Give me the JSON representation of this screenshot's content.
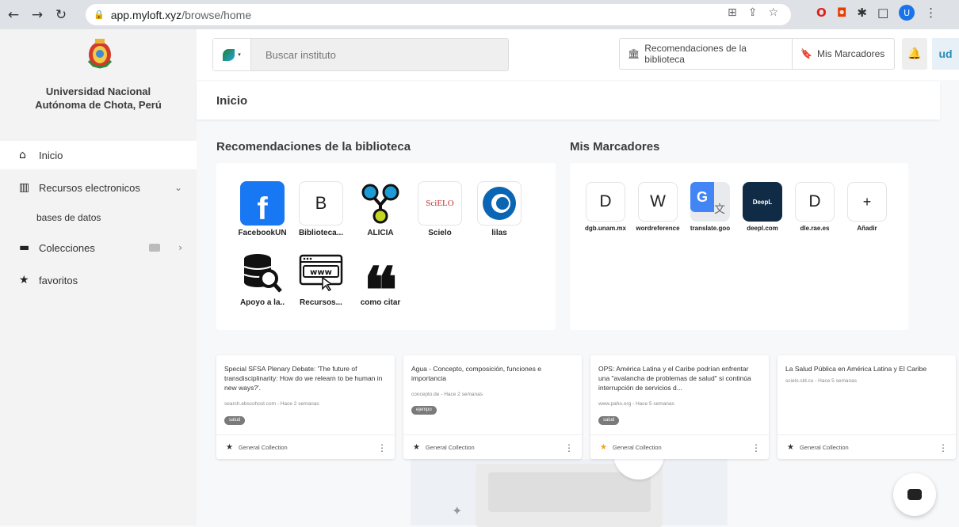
{
  "browser": {
    "url_domain": "app.myloft.xyz",
    "url_path": "/browse/home",
    "profile_initial": "U"
  },
  "sidebar": {
    "university_name": "Universidad Nacional Autónoma de Chota, Perú",
    "items": [
      {
        "label": "Inicio",
        "icon": "home-icon"
      },
      {
        "label": "Recursos electronicos",
        "icon": "book-icon"
      },
      {
        "label": "bases de datos"
      },
      {
        "label": "Colecciones",
        "icon": "archive-icon"
      },
      {
        "label": "favoritos",
        "icon": "star-icon"
      }
    ]
  },
  "topbar": {
    "search_placeholder": "Buscar instituto",
    "recommendations_label": "Recomendaciones de la biblioteca",
    "bookmarks_label": "Mis Marcadores",
    "user_initials": "ud"
  },
  "breadcrumb": {
    "title": "Inicio"
  },
  "recommendations": {
    "title": "Recomendaciones de la biblioteca",
    "items": [
      {
        "label": "FacebookUN",
        "glyph": "f"
      },
      {
        "label": "Biblioteca...",
        "glyph": "B"
      },
      {
        "label": "ALICIA",
        "glyph": ""
      },
      {
        "label": "Scielo",
        "glyph": "SciELO"
      },
      {
        "label": "lilas",
        "glyph": ""
      },
      {
        "label": "Apoyo a la..",
        "glyph": ""
      },
      {
        "label": "Recursos...",
        "glyph": "www"
      },
      {
        "label": "como citar",
        "glyph": "❝"
      }
    ]
  },
  "bookmarks": {
    "title": "Mis Marcadores",
    "items": [
      {
        "label": "dgb.unam.mx",
        "glyph": "D"
      },
      {
        "label": "wordreference",
        "glyph": "W"
      },
      {
        "label": "translate.goo",
        "glyph": "G"
      },
      {
        "label": "deepl.com",
        "glyph": "DeepL"
      },
      {
        "label": "dle.rae.es",
        "glyph": "D"
      },
      {
        "label": "Añadir",
        "glyph": "+"
      }
    ]
  },
  "cards": [
    {
      "title": "Special SFSA Plenary Debate: 'The future of transdisciplinarity: How do we relearn to be human in new ways?'.",
      "source": "search.ebscohost.com - Hace 2 semanas",
      "tag": "salud",
      "collection": "General Collection",
      "starred": false
    },
    {
      "title": "Agua - Concepto, composición, funciones e importancia",
      "source": "concepto.de - Hace 2 semanas",
      "tag": "ejempo",
      "collection": "General Collection",
      "starred": false
    },
    {
      "title": "OPS: América Latina y el Caribe podrían enfrentar una \"avalancha de problemas de salud\" si continúa interrupción de servicios d...",
      "source": "www.paho.org - Hace 5 semanas",
      "tag": "salud",
      "collection": "General Collection",
      "starred": true
    },
    {
      "title": "La Salud Pública en América Latina y El Caribe",
      "source": "scielo.sld.cu - Hace 5 semanas",
      "tag": "",
      "collection": "General Collection",
      "starred": false
    }
  ],
  "colors": {
    "accent": "#2a8bb5",
    "star_gold": "#f4a020",
    "facebook": "#1877f2",
    "deepl": "#0f2b46"
  }
}
